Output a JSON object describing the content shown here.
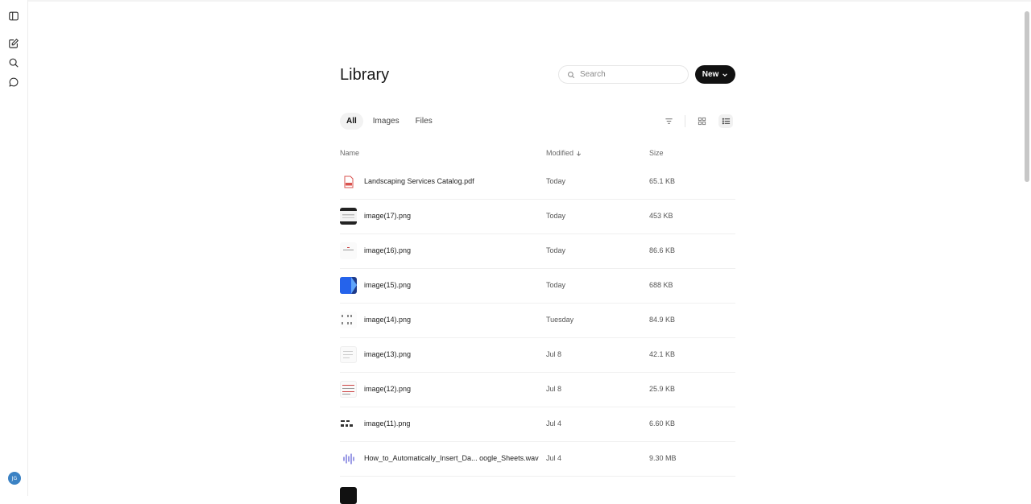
{
  "library": {
    "title": "Library",
    "search_placeholder": "Search",
    "new_label": "New"
  },
  "tabs": [
    {
      "label": "All",
      "active": true
    },
    {
      "label": "Images",
      "active": false
    },
    {
      "label": "Files",
      "active": false
    }
  ],
  "columns": {
    "name": "Name",
    "modified": "Modified",
    "size": "Size"
  },
  "files": [
    {
      "name": "Landscaping Services Catalog.pdf",
      "modified": "Today",
      "size": "65.1 KB",
      "icon": "pdf-icon"
    },
    {
      "name": "image(17).png",
      "modified": "Today",
      "size": "453 KB",
      "icon": "image-thumbnail"
    },
    {
      "name": "image(16).png",
      "modified": "Today",
      "size": "86.6 KB",
      "icon": "image-thumbnail"
    },
    {
      "name": "image(15).png",
      "modified": "Today",
      "size": "688 KB",
      "icon": "image-thumbnail"
    },
    {
      "name": "image(14).png",
      "modified": "Tuesday",
      "size": "84.9 KB",
      "icon": "image-thumbnail"
    },
    {
      "name": "image(13).png",
      "modified": "Jul 8",
      "size": "42.1 KB",
      "icon": "image-thumbnail"
    },
    {
      "name": "image(12).png",
      "modified": "Jul 8",
      "size": "25.9 KB",
      "icon": "image-thumbnail"
    },
    {
      "name": "image(11).png",
      "modified": "Jul 4",
      "size": "6.60 KB",
      "icon": "image-thumbnail"
    },
    {
      "name": "How_to_Automatically_Insert_Da... oogle_Sheets.wav",
      "modified": "Jul 4",
      "size": "9.30 MB",
      "icon": "audio-icon"
    }
  ],
  "user": {
    "initials": "JG"
  },
  "colors": {
    "accent": "#111111",
    "avatar": "#3b82c4",
    "pdf_red": "#d9534f"
  }
}
